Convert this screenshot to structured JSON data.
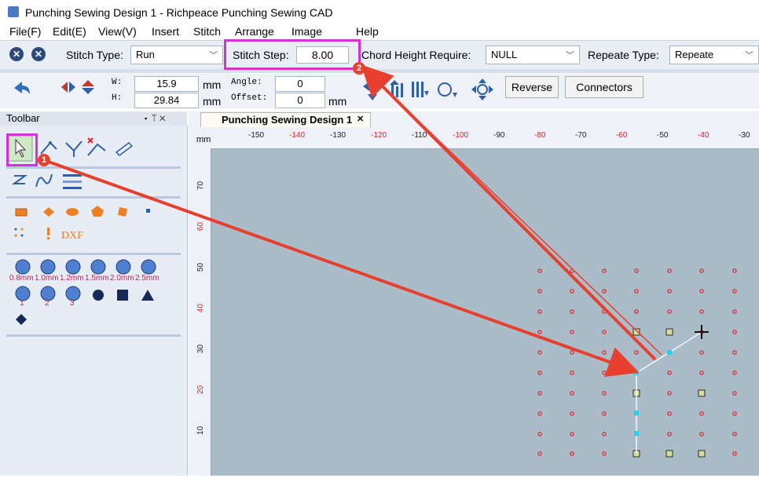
{
  "window": {
    "title": "Punching Sewing Design 1 - Richpeace Punching Sewing CAD"
  },
  "menu": {
    "file": "File(F)",
    "edit": "Edit(E)",
    "view": "View(V)",
    "insert": "Insert",
    "stitch": "Stitch",
    "arrange": "Arrange",
    "image": "Image",
    "help": "Help"
  },
  "props": {
    "stitch_type_label": "Stitch Type:",
    "stitch_type_value": "Run",
    "stitch_step_label": "Stitch Step:",
    "stitch_step_value": "8.00",
    "chord_label": "Chord Height Require:",
    "chord_value": "NULL",
    "repeat_label": "Repeate Type:",
    "repeat_value": "Repeate"
  },
  "transform": {
    "w_label": "W:",
    "w_value": "15.9",
    "h_label": "H:",
    "h_value": "29.84",
    "unit": "mm",
    "angle_label": "Angle:",
    "angle_value": "0",
    "offset_label": "Offset:",
    "offset_value": "0",
    "reverse_label": "Reverse",
    "connectors_label": "Connectors"
  },
  "toolbar_panel": {
    "title": "Toolbar",
    "pin": "▾ ᛘ ✕",
    "dxf": "DXF",
    "size_labels": [
      "0.8mm",
      "1.0mm",
      "1.2mm",
      "1.5mm",
      "2.0mm",
      "2.5mm"
    ],
    "numbered_labels": [
      "1",
      "2",
      "3"
    ]
  },
  "tab": {
    "label": "Punching Sewing Design 1",
    "close": "✕"
  },
  "ruler": {
    "unit": "mm",
    "top": [
      "-150",
      "-140",
      "-130",
      "-120",
      "-110",
      "-100",
      "-90",
      "-80",
      "-70",
      "-60",
      "-50",
      "-40",
      "-30"
    ],
    "left": [
      "70",
      "60",
      "50",
      "40",
      "30",
      "20",
      "10"
    ]
  },
  "annotations": {
    "badge1": "1",
    "badge2": "2"
  },
  "colors": {
    "accent": "#d532d5",
    "arrow": "#e8402f",
    "canvas": "#a9bcc8",
    "dot": "#e0202a",
    "stitch": "#22d3ee"
  }
}
